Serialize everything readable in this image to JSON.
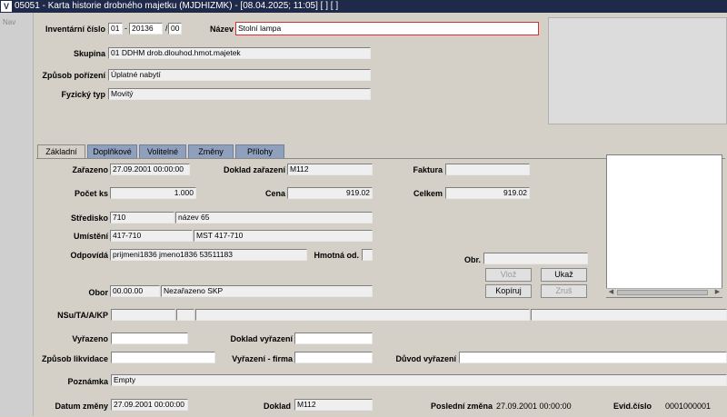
{
  "window": {
    "title": "05051 - Karta historie drobného majetku (MJDHIZMK) - [08.04.2025; 11:05]  [ ]  [ ]",
    "nav_label": "Nav"
  },
  "header": {
    "inv_label": "Inventární číslo",
    "inv_part1": "01",
    "inv_sep1": "-",
    "inv_part2": "20136",
    "inv_sep2": "/",
    "inv_part3": "00",
    "nazev_label": "Název",
    "nazev_value": "Stolní lampa",
    "skupina_label": "Skupina",
    "skupina_value": "01 DDHM drob.dlouhod.hmot.majetek",
    "zpusob_label": "Způsob pořízení",
    "zpusob_value": "Úplatné nabytí",
    "typ_label": "Fyzický typ",
    "typ_value": "Movitý"
  },
  "tabs": [
    {
      "label": "Základní",
      "active": true
    },
    {
      "label": "Doplňkové",
      "active": false
    },
    {
      "label": "Volitelné",
      "active": false
    },
    {
      "label": "Změny",
      "active": false
    },
    {
      "label": "Přílohy",
      "active": false
    }
  ],
  "basic": {
    "zarazeno_label": "Zařazeno",
    "zarazeno_value": "27.09.2001 00:00:00",
    "doklad_zar_label": "Doklad zařazení",
    "doklad_zar_value": "M112",
    "faktura_label": "Faktura",
    "faktura_value": "",
    "pocet_label": "Počet ks",
    "pocet_value": "1.000",
    "cena_label": "Cena",
    "cena_value": "919.02",
    "celkem_label": "Celkem",
    "celkem_value": "919.02",
    "stredisko_label": "Středisko",
    "stredisko_code": "710",
    "stredisko_name": "název 65",
    "umisteni_label": "Umístění",
    "umisteni_code": "417-710",
    "umisteni_name": "MST 417-710",
    "odpovida_label": "Odpovídá",
    "odpovida_value": "prijmeni1836 jmeno1836 53511183",
    "hmotna_label": "Hmotná od.",
    "hmotna_value": "",
    "obr_label": "Obr.",
    "obr_value": "",
    "obor_label": "Obor",
    "obor_code": "00.00.00",
    "obor_name": "Nezařazeno SKP",
    "nsu_label": "NSu/TA/A/KP",
    "vyrazeno_label": "Vyřazeno",
    "vyrazeno_value": "",
    "doklad_vyr_label": "Doklad vyřazení",
    "doklad_vyr_value": "",
    "zpusob_likv_label": "Způsob likvidace",
    "zpusob_likv_value": "",
    "vyr_firma_label": "Vyřazení - firma",
    "vyr_firma_value": "",
    "duvod_label": "Důvod vyřazení",
    "duvod_value": "",
    "poznamka_label": "Poznámka",
    "poznamka_value": "Empty",
    "datum_zm_label": "Datum změny",
    "datum_zm_value": "27.09.2001 00:00:00",
    "doklad_label": "Doklad",
    "doklad_value": "M112",
    "posledni_label": "Poslední změna",
    "posledni_value": "27.09.2001 00:00:00",
    "evid_label": "Evid.číslo",
    "evid_value": "0001000001"
  },
  "buttons": {
    "vloz": "Vlož",
    "ukaz": "Ukaž",
    "kopiruj": "Kopíruj",
    "zrus": "Zruš"
  }
}
